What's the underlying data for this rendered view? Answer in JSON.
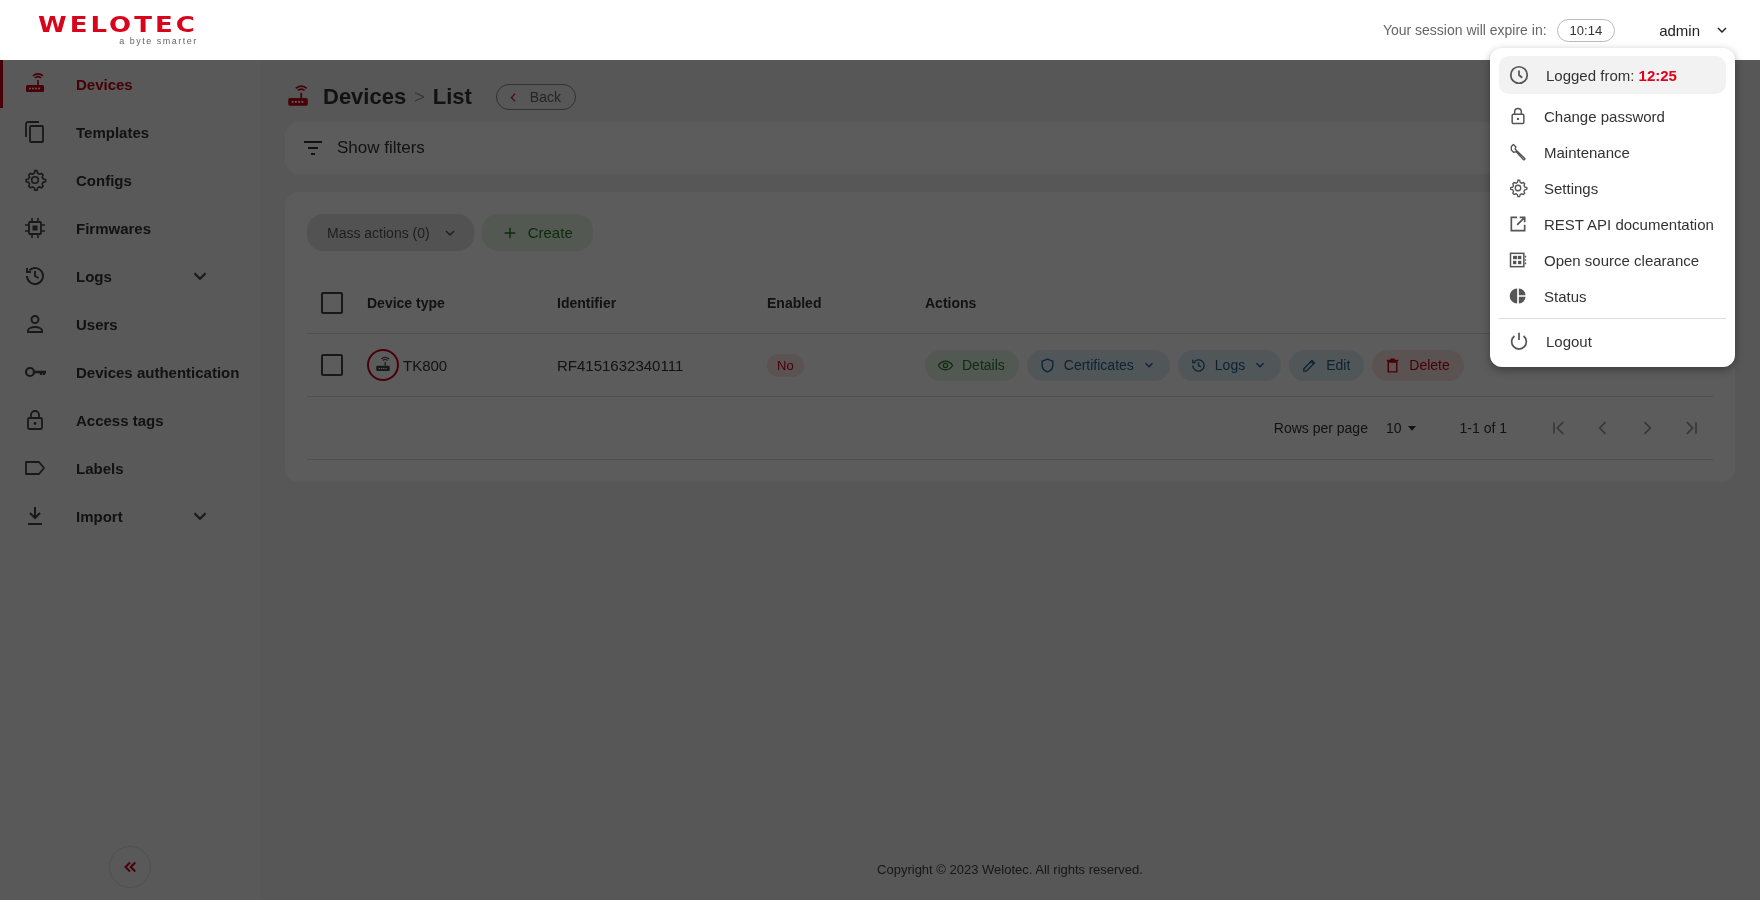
{
  "header": {
    "logo": "WELOTEC",
    "tagline": "a byte smarter",
    "session_label": "Your session will expire in:",
    "session_timer": "10:14",
    "user": "admin"
  },
  "sidebar": {
    "items": [
      {
        "label": "Devices",
        "selected": true,
        "has_submenu": false
      },
      {
        "label": "Templates",
        "selected": false,
        "has_submenu": false
      },
      {
        "label": "Configs",
        "selected": false,
        "has_submenu": false
      },
      {
        "label": "Firmwares",
        "selected": false,
        "has_submenu": false
      },
      {
        "label": "Logs",
        "selected": false,
        "has_submenu": true
      },
      {
        "label": "Users",
        "selected": false,
        "has_submenu": false
      },
      {
        "label": "Devices authentication",
        "selected": false,
        "has_submenu": false
      },
      {
        "label": "Access tags",
        "selected": false,
        "has_submenu": false
      },
      {
        "label": "Labels",
        "selected": false,
        "has_submenu": false
      },
      {
        "label": "Import",
        "selected": false,
        "has_submenu": true
      }
    ]
  },
  "breadcrumb": {
    "items": [
      "Devices",
      "List"
    ],
    "separator": ">",
    "back": "Back"
  },
  "filters": {
    "label": "Show filters"
  },
  "toolbar": {
    "mass_actions": {
      "label": "Mass actions (0)",
      "disabled": true
    },
    "create": "Create"
  },
  "table": {
    "header_checked": false,
    "columns": [
      "Device type",
      "Identifier",
      "Enabled",
      "Actions"
    ],
    "rows": [
      {
        "checked": false,
        "device_type": "TK800",
        "identifier": "RF4151632340111",
        "enabled": false,
        "enabled_label": "No",
        "actions": [
          {
            "label": "Details",
            "kind": "details",
            "has_menu": false
          },
          {
            "label": "Certificates",
            "kind": "certificates",
            "has_menu": true
          },
          {
            "label": "Logs",
            "kind": "logs",
            "has_menu": true
          },
          {
            "label": "Edit",
            "kind": "edit",
            "has_menu": false
          },
          {
            "label": "Delete",
            "kind": "delete",
            "has_menu": false
          }
        ]
      }
    ]
  },
  "pagination": {
    "rows_per_page_label": "Rows per page",
    "rows_per_page": "10",
    "range": "1-1 of 1"
  },
  "footer": {
    "copyright": "Copyright © 2023 Welotec. All rights reserved."
  },
  "user_menu": {
    "logged_label": "Logged from:",
    "logged_time": "12:25",
    "items": [
      {
        "label": "Change password",
        "kind": "lock"
      },
      {
        "label": "Maintenance",
        "kind": "wrench"
      },
      {
        "label": "Settings",
        "kind": "gear"
      },
      {
        "label": "REST API documentation",
        "kind": "external"
      },
      {
        "label": "Open source clearance",
        "kind": "clearance"
      },
      {
        "label": "Status",
        "kind": "pie"
      }
    ],
    "logout": "Logout"
  }
}
